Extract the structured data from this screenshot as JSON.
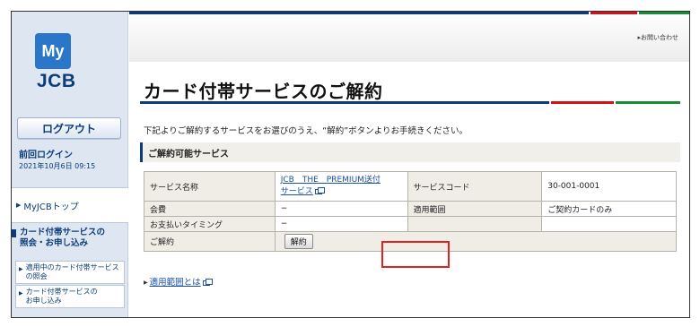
{
  "brand": {
    "logo_my": "My",
    "logo_jcb": "JCB"
  },
  "sidebar": {
    "logout_label": "ログアウト",
    "last_login_label": "前回ログイン",
    "last_login_date": "2021年10月6日 09:15",
    "nav_top": "MyJCBトップ",
    "nav_group": {
      "line1": "カード付帯サービスの",
      "line2": "照会・お申し込み"
    },
    "sub_items": [
      {
        "line1": "適用中のカード付帯サービス",
        "line2": "の照会"
      },
      {
        "line1": "カード付帯サービスの",
        "line2": "お申し込み"
      }
    ]
  },
  "header": {
    "help_link": "お問い合わせ"
  },
  "main": {
    "title": "カード付帯サービスのご解約",
    "intro": "下記よりご解約するサービスをお選びのうえ、“解約”ボタンよりお手続きください。",
    "section_title": "ご解約可能サービス",
    "table": {
      "service_name_label": "サービス名称",
      "service_name_line1": "JCB　THE　PREMIUM送付",
      "service_name_line2": "サービス",
      "service_code_label": "サービスコード",
      "service_code_value": "30-001-0001",
      "fee_label": "会費",
      "fee_value": "−",
      "scope_label": "適用範囲",
      "scope_value": "ご契約カードのみ",
      "timing_label": "お支払いタイミング",
      "timing_value": "−",
      "cancel_label": "ご解約",
      "cancel_button": "解約"
    },
    "scope_link": "適用範囲とは"
  },
  "colors": {
    "navy": "#0c3c7a",
    "accent_red": "#d0131a",
    "accent_green": "#1a8a3a",
    "highlight": "#e2211c"
  }
}
